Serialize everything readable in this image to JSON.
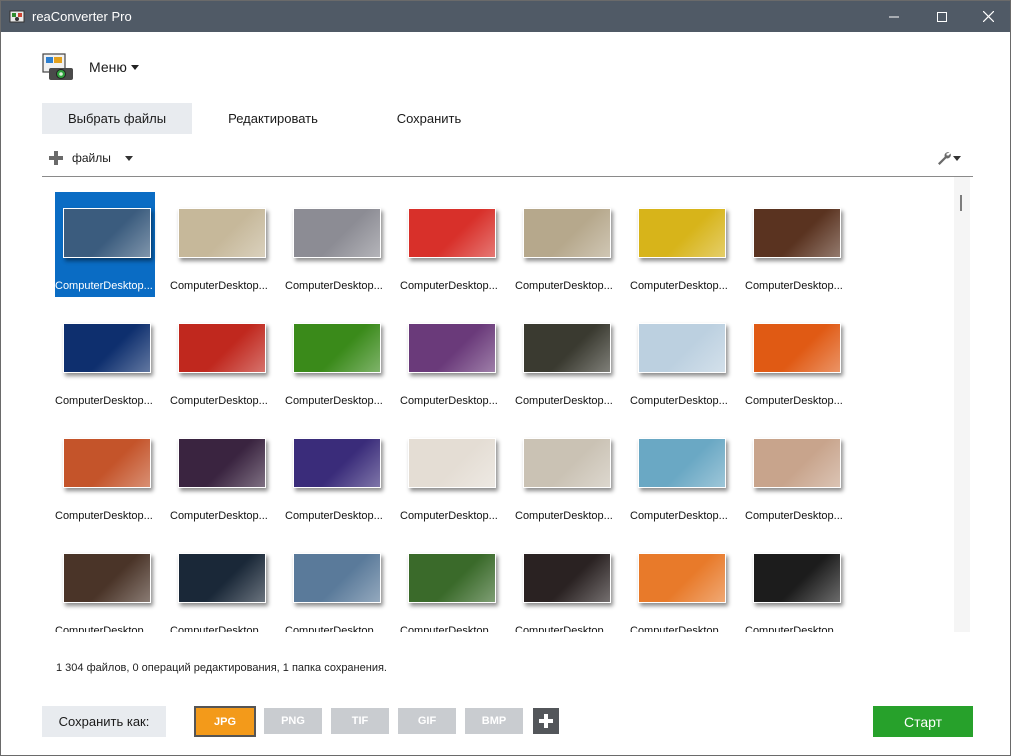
{
  "window": {
    "title": "reaConverter Pro"
  },
  "menu": {
    "label": "Меню"
  },
  "tabs": [
    {
      "label": "Выбрать файлы",
      "active": true
    },
    {
      "label": "Редактировать",
      "active": false
    },
    {
      "label": "Сохранить",
      "active": false
    }
  ],
  "toolbar": {
    "add_files_label": "файлы"
  },
  "files": {
    "visible_label": "ComputerDesktop...",
    "partial_label": "ComputerDesktop",
    "thumbnail_colors": [
      [
        "#3b5c7e",
        "#c6b89a",
        "#8c8c94",
        "#d8302a",
        "#b6a88c",
        "#d7b41a",
        "#5a3320"
      ],
      [
        "#0e2f6e",
        "#c0281e",
        "#3a8a1a",
        "#6a3a7a",
        "#3a3a30",
        "#bcd0e0",
        "#e05a14"
      ],
      [
        "#c4542a",
        "#3a2440",
        "#3a2c7a",
        "#e4ddd4",
        "#cac2b4",
        "#6aa8c4",
        "#c8a48c"
      ],
      [
        "#4a3428",
        "#1a2838",
        "#5a7a9a",
        "#3a6a2a",
        "#2a2222",
        "#e87a2a",
        "#1c1c1c"
      ]
    ],
    "selected_index": 0
  },
  "status": "1 304 файлов, 0 операций редактирования, 1 папка сохранения.",
  "bottom": {
    "save_as_label": "Сохранить как:",
    "formats": [
      "JPG",
      "PNG",
      "TIF",
      "GIF",
      "BMP"
    ],
    "active_format": "JPG",
    "start_label": "Старт"
  },
  "colors": {
    "titlebar": "#505a66",
    "selection": "#0a6cc4",
    "active_format": "#f39a1a",
    "start": "#27a12b"
  }
}
